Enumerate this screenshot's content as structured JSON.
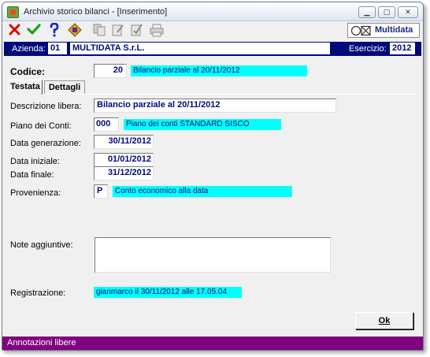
{
  "window": {
    "title": "Archivio storico bilanci - [Inserimento]",
    "controls": [
      "minimize",
      "maximize",
      "close"
    ]
  },
  "toolbar": {
    "icons": [
      "cancel-icon",
      "confirm-icon",
      "help-icon",
      "diamond-icon",
      "copy-icon",
      "edit-icon",
      "edit-check-icon",
      "print-icon"
    ],
    "logo_label": "Multidata"
  },
  "header": {
    "azienda_label": "Azienda:",
    "azienda_code": "01",
    "azienda_name": "MULTIDATA S.r.L.",
    "esercizio_label": "Esercizio:",
    "esercizio_value": "2012"
  },
  "codice": {
    "label": "Codice:",
    "value": "20",
    "description": "Bilancio parziale al 20/11/2012"
  },
  "tabs": [
    {
      "label": "Testata",
      "active": true
    },
    {
      "label": "Dettagli",
      "active": false
    }
  ],
  "form": {
    "descrizione_label": "Descrizione libera:",
    "descrizione_value": "Bilancio parziale al 20/11/2012",
    "piano_label": "Piano dei Conti:",
    "piano_code": "000",
    "piano_description": "Piano dei conti STANDARD SISCO",
    "data_generazione_label": "Data generazione:",
    "data_generazione_value": "30/11/2012",
    "data_iniziale_label": "Data iniziale:",
    "data_iniziale_value": "01/01/2012",
    "data_finale_label": "Data finale:",
    "data_finale_value": "31/12/2012",
    "provenienza_label": "Provenienza:",
    "provenienza_code": "P",
    "provenienza_description": "Conto economico alla data",
    "note_label": "Note aggiuntive:",
    "note_value": "",
    "registrazione_label": "Registrazione:",
    "registrazione_value": "gianmarco il 30/11/2012 alle 17.05.04"
  },
  "buttons": {
    "ok_label": "Ok"
  },
  "status": {
    "text": "Annotazioni libere"
  },
  "colors": {
    "header_bar": "#000a78",
    "highlight": "#00ffff",
    "status_bar": "#800080",
    "field_text": "#000a78"
  }
}
